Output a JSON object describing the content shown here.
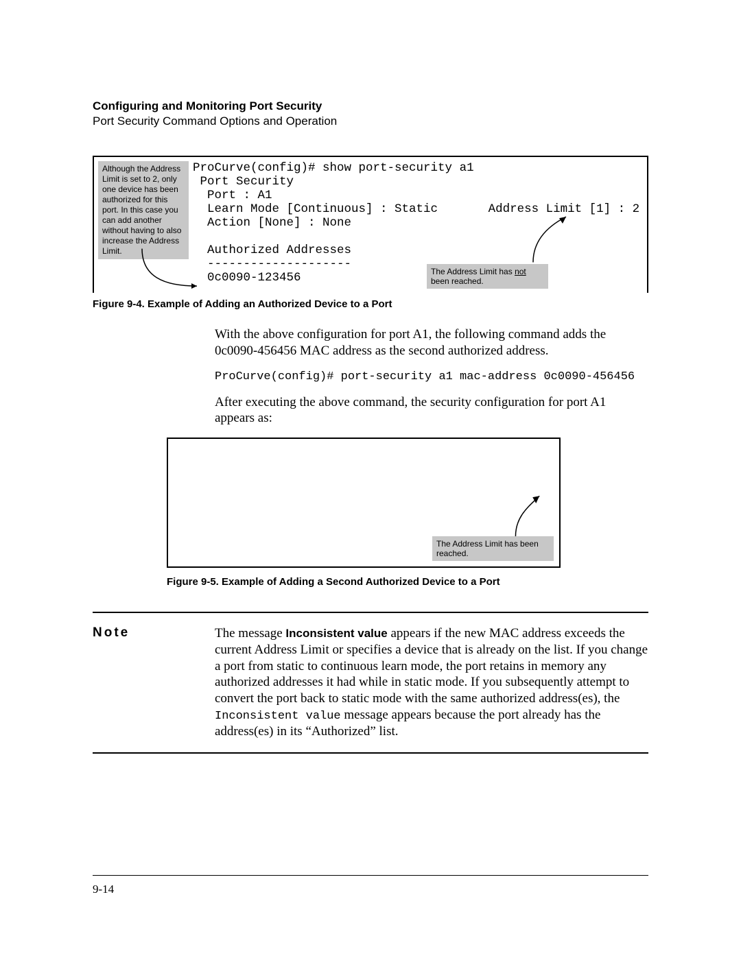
{
  "header": {
    "title": "Configuring and Monitoring Port Security",
    "subtitle": "Port Security Command Options and Operation"
  },
  "figure1": {
    "callout_left": "Although the Address Limit is set to 2, only one device has been authorized for this port. In this case you can add another without having to also increase the Address Limit.",
    "terminal": "ProCurve(config)# show port-security a1\n Port Security\n  Port : A1\n  Learn Mode [Continuous] : Static       Address Limit [1] : 2\n  Action [None] : None\n\n  Authorized Addresses\n  --------------------\n  0c0090-123456",
    "callout_right_a": "The Address Limit has ",
    "callout_right_u": "not",
    "callout_right_b": " been reached.",
    "caption": "Figure 9-4. Example of Adding an Authorized Device to a Port"
  },
  "body": {
    "para1": "With the above configuration for port A1, the following command adds the 0c0090-456456 MAC address as the second authorized address.",
    "code": "ProCurve(config)# port-security a1 mac-address 0c0090-456456",
    "para2": "After executing the above command, the security configuration for port A1 appears as:"
  },
  "figure2": {
    "callout_right": "The Address Limit has been reached.",
    "caption": "Figure 9-5. Example of Adding a Second Authorized Device to a Port"
  },
  "note": {
    "label": "Note",
    "text_a": "The message ",
    "text_bold": "Inconsistent value",
    "text_b": " appears if the new MAC address exceeds the current Address Limit or specifies a device that is already on the list. If you change a port from static to continuous learn mode, the port retains in memory any authorized addresses it had while in static mode. If you subsequently attempt to convert the port back to static mode with the same authorized address(es), the ",
    "text_code": "Inconsistent value",
    "text_c": " message appears because the port already has the address(es) in its “Authorized” list."
  },
  "footer": {
    "page": "9-14"
  }
}
